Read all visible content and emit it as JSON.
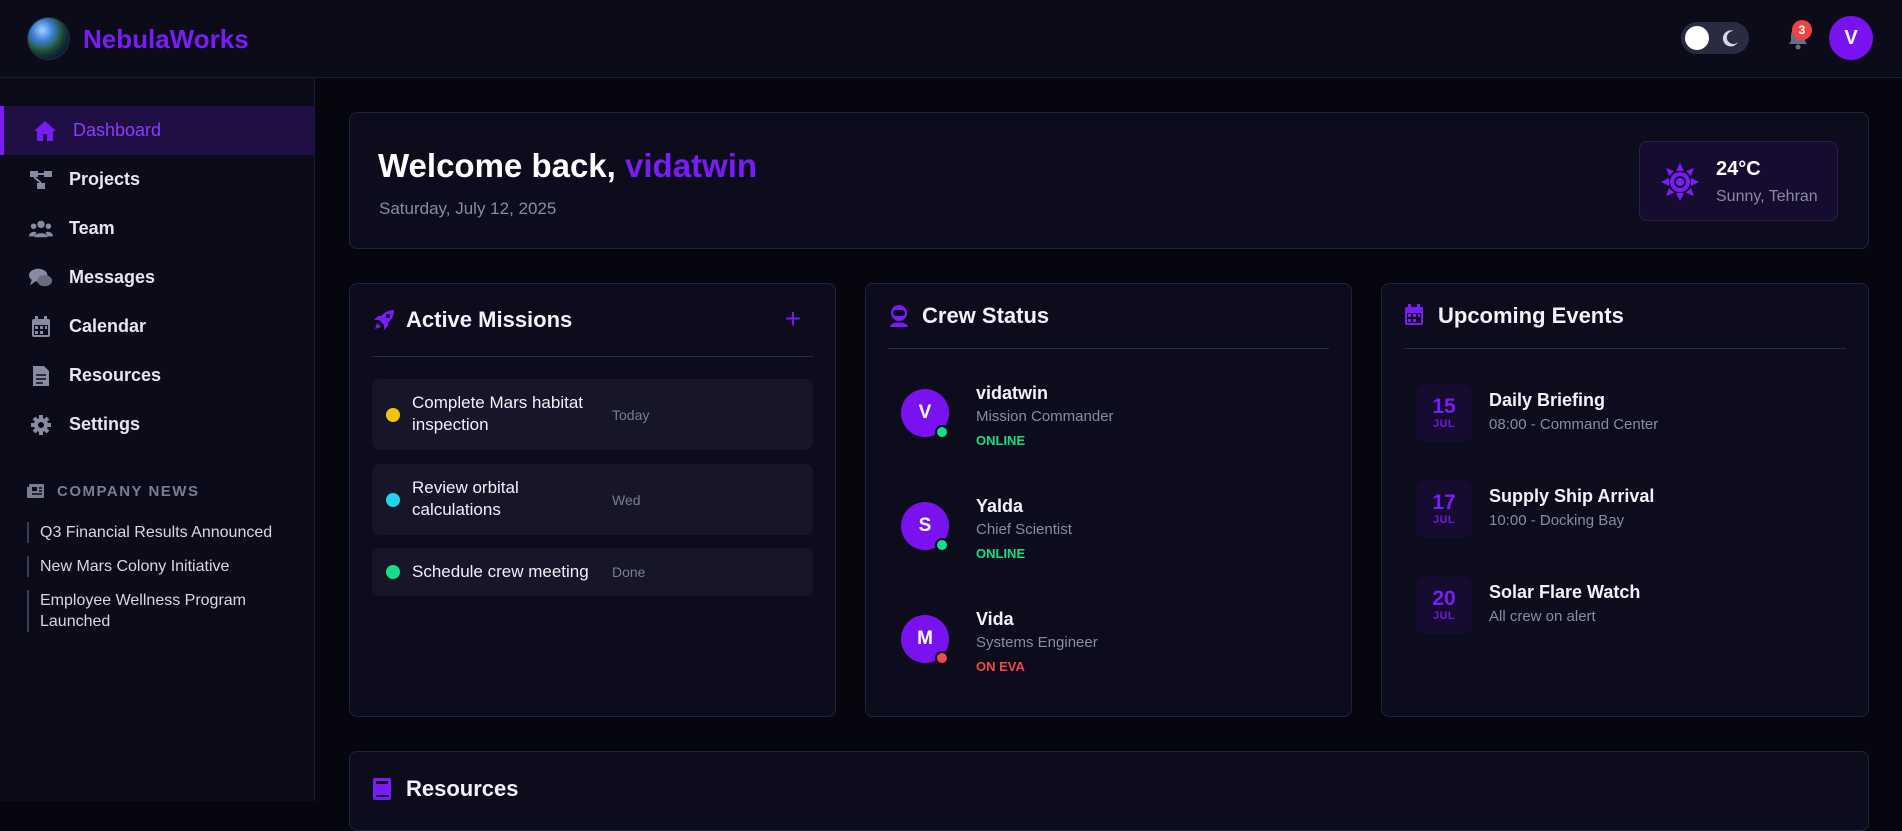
{
  "app": {
    "brand": "NebulaWorks"
  },
  "header": {
    "notification_count": "3",
    "user_initial": "V",
    "theme": "dark"
  },
  "sidebar": {
    "items": [
      {
        "label": "Dashboard",
        "icon": "home-icon",
        "active": true
      },
      {
        "label": "Projects",
        "icon": "project-diagram-icon"
      },
      {
        "label": "Team",
        "icon": "users-icon"
      },
      {
        "label": "Messages",
        "icon": "comments-icon"
      },
      {
        "label": "Calendar",
        "icon": "calendar-icon"
      },
      {
        "label": "Resources",
        "icon": "file-icon"
      },
      {
        "label": "Settings",
        "icon": "gear-icon"
      }
    ],
    "news_heading": "COMPANY NEWS",
    "news": [
      "Q3 Financial Results Announced",
      "New Mars Colony Initiative",
      "Employee Wellness Program Launched"
    ]
  },
  "welcome": {
    "greeting": "Welcome back,",
    "username": "vidatwin",
    "date": "Saturday, July 12, 2025",
    "weather": {
      "temp": "24°C",
      "desc": "Sunny, Tehran"
    }
  },
  "missions": {
    "title": "Active Missions",
    "items": [
      {
        "text": "Complete Mars habitat inspection",
        "date": "Today",
        "color": "#f5c211"
      },
      {
        "text": "Review orbital calculations",
        "date": "Wed",
        "color": "#22d3ee"
      },
      {
        "text": "Schedule crew meeting",
        "date": "Done",
        "color": "#10e08a"
      }
    ]
  },
  "crew": {
    "title": "Crew Status",
    "members": [
      {
        "initial": "V",
        "name": "vidatwin",
        "role": "Mission Commander",
        "status": "ONLINE",
        "status_color": "#10e08a"
      },
      {
        "initial": "S",
        "name": "Yalda",
        "role": "Chief Scientist",
        "status": "ONLINE",
        "status_color": "#10e08a"
      },
      {
        "initial": "M",
        "name": "Vida",
        "role": "Systems Engineer",
        "status": "ON EVA",
        "status_color": "#f04a4a"
      }
    ]
  },
  "events": {
    "title": "Upcoming Events",
    "items": [
      {
        "day": "15",
        "month": "JUL",
        "title": "Daily Briefing",
        "sub": "08:00 - Command Center"
      },
      {
        "day": "17",
        "month": "JUL",
        "title": "Supply Ship Arrival",
        "sub": "10:00 - Docking Bay"
      },
      {
        "day": "20",
        "month": "JUL",
        "title": "Solar Flare Watch",
        "sub": "All crew on alert"
      }
    ]
  },
  "resources": {
    "title": "Resources"
  },
  "colors": {
    "accent": "#7a1cf5",
    "background": "#06060f",
    "panel": "#0c0c1c"
  }
}
